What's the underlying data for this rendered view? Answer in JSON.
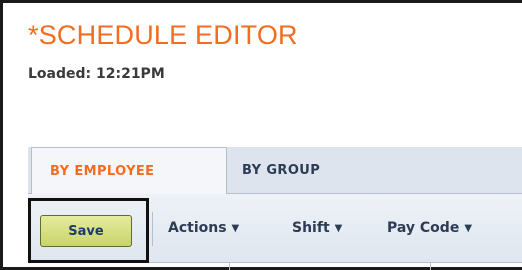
{
  "header": {
    "title": "*SCHEDULE EDITOR",
    "loaded_text": "Loaded: 12:21PM"
  },
  "tabs": [
    {
      "label": "BY EMPLOYEE",
      "active": true
    },
    {
      "label": "BY GROUP",
      "active": false
    }
  ],
  "toolbar": {
    "save_label": "Save",
    "menus": [
      {
        "label": "Actions",
        "caret": "▼"
      },
      {
        "label": "Shift",
        "caret": "▼"
      },
      {
        "label": "Pay Code",
        "caret": "▼"
      }
    ]
  },
  "colors": {
    "title": "#f26d1f",
    "active_tab_text": "#f26d1f",
    "save_button": "#d6de80",
    "toolbar_text": "#2c3c55"
  }
}
